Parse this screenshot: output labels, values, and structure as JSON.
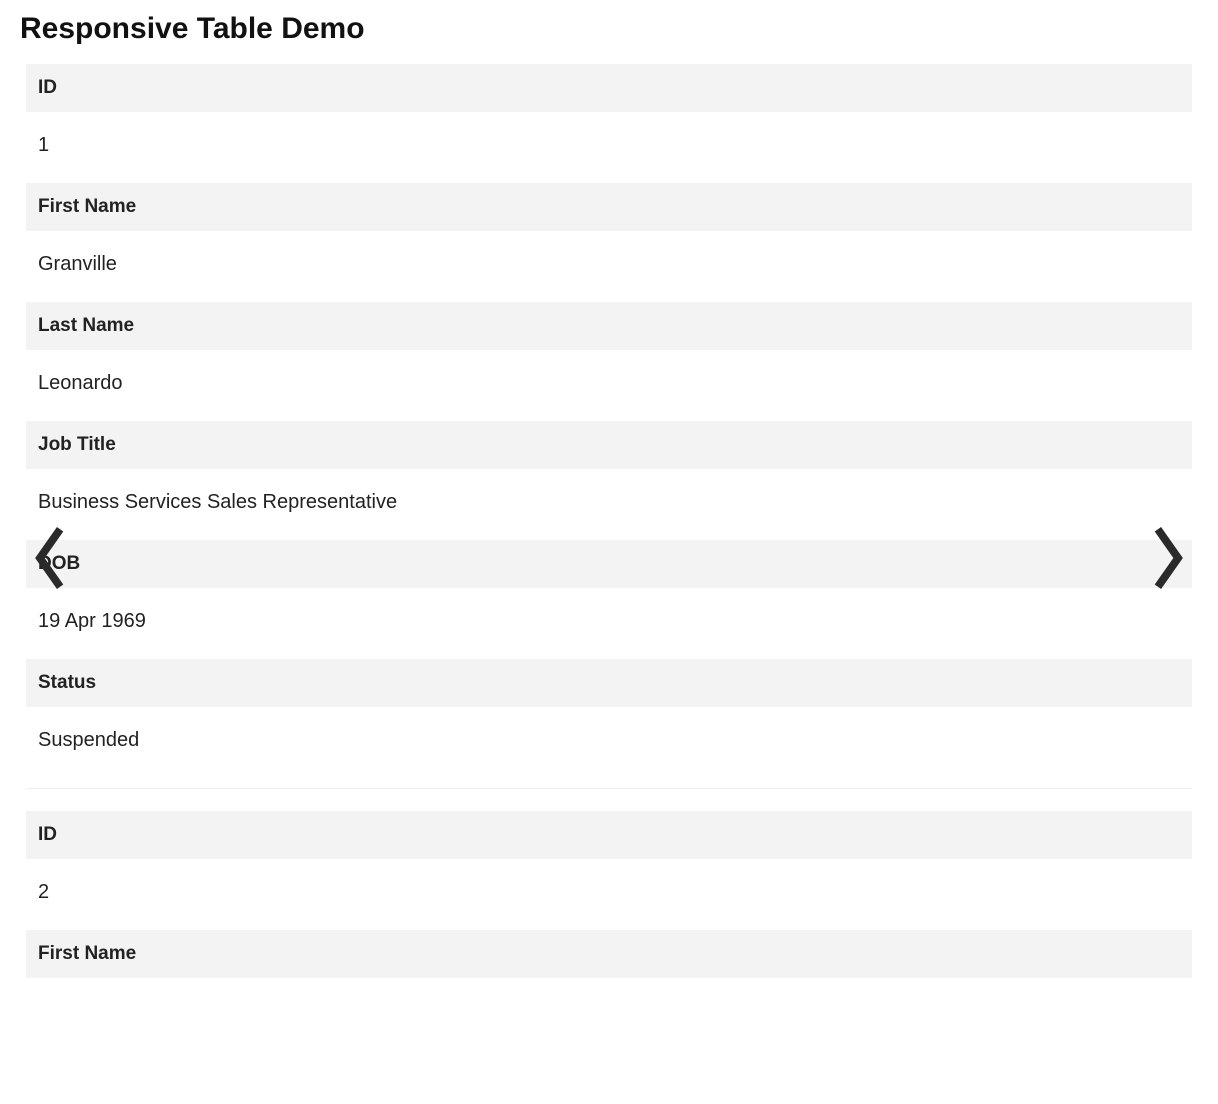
{
  "title": "Responsive Table Demo",
  "fields": {
    "id": "ID",
    "first_name": "First Name",
    "last_name": "Last Name",
    "job_title": "Job Title",
    "dob": "DOB",
    "status": "Status"
  },
  "records": [
    {
      "id": "1",
      "first_name": "Granville",
      "last_name": "Leonardo",
      "job_title": "Business Services Sales Representative",
      "dob": "19 Apr 1969",
      "status": "Suspended"
    },
    {
      "id": "2",
      "first_name": "",
      "last_name": "",
      "job_title": "",
      "dob": "",
      "status": ""
    }
  ]
}
